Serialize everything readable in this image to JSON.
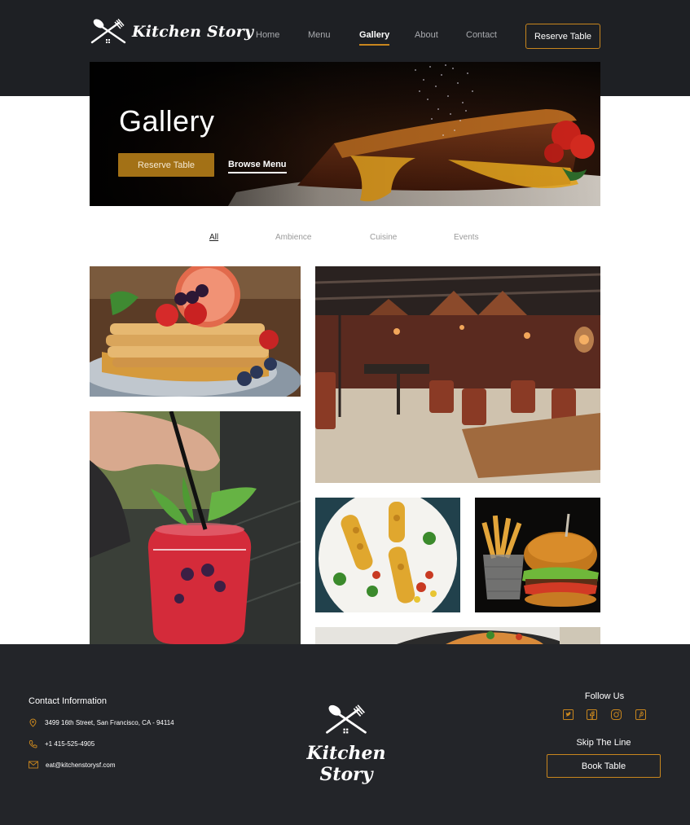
{
  "header": {
    "logo_text": "Kitchen Story",
    "nav": [
      {
        "label": "Home"
      },
      {
        "label": "Menu"
      },
      {
        "label": "Gallery"
      },
      {
        "label": "About"
      },
      {
        "label": "Contact"
      }
    ],
    "active_nav": "Gallery",
    "reserve_label": "Reserve Table"
  },
  "hero": {
    "title": "Gallery",
    "reserve_label": "Reserve Table",
    "browse_label": "Browse Menu"
  },
  "filters": [
    {
      "label": "All"
    },
    {
      "label": "Ambience"
    },
    {
      "label": "Cuisine"
    },
    {
      "label": "Events"
    }
  ],
  "active_filter": "All",
  "gallery": [
    {
      "name": "pancakes-photo"
    },
    {
      "name": "cocktail-photo"
    },
    {
      "name": "restaurant-interior-photo"
    },
    {
      "name": "skewers-plate-photo"
    },
    {
      "name": "burger-fries-photo"
    },
    {
      "name": "dish-photo"
    }
  ],
  "footer": {
    "contact_title": "Contact Information",
    "address": "3499 16th Street, San Francisco, CA - 94114",
    "phone": "+1 415-525-4905",
    "email": "eat@kitchenstorysf.com",
    "logo_text": "Kitchen Story",
    "follow_title": "Follow Us",
    "social_icons": [
      "twitter-icon",
      "facebook-icon",
      "instagram-icon",
      "pinterest-icon"
    ],
    "skip_title": "Skip The Line",
    "book_label": "Book Table"
  },
  "colors": {
    "header_bg": "#1e2024",
    "footer_bg": "#232529",
    "accent": "#c8861e",
    "hero_button": "#a37116"
  }
}
